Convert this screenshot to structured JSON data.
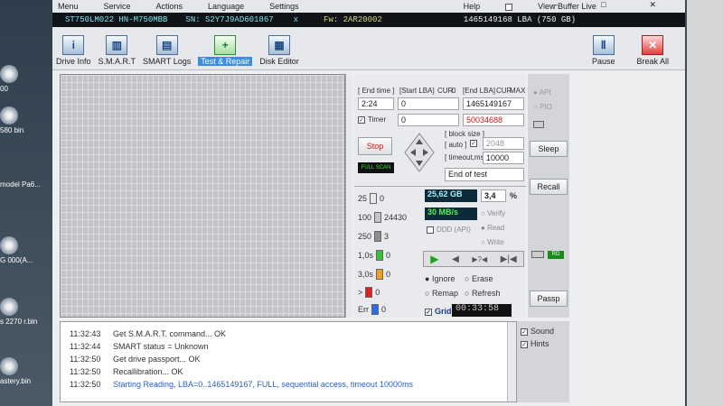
{
  "menu": {
    "items": [
      "Menu",
      "Service",
      "Actions",
      "Language",
      "Settings",
      "Help"
    ],
    "view_buffer": "View Buffer Live"
  },
  "info": {
    "model": "ST750LM022 HN-M750MBB",
    "serial": "SN: S2Y7J9AD601867",
    "close": "x",
    "fw": "Fw: 2AR20002",
    "lba": "1465149168 LBA (750 GB)"
  },
  "toolbar": {
    "drive_info": "Drive Info",
    "smart": "S.M.A.R.T",
    "smart_logs": "SMART Logs",
    "test_repair": "Test & Repair",
    "disk_editor": "Disk Editor",
    "pause": "Pause",
    "break_all": "Break All"
  },
  "controls": {
    "end_time_label": "[ End time ]",
    "start_lba_label": "[Start LBA]",
    "cur": "CUR",
    "zero": "0",
    "end_lba_label": "[End LBA]",
    "max": "MAX",
    "end_time": "2:24",
    "start_lba": "0",
    "end_lba": "1465149167",
    "timer_label": "Timer",
    "timer_value": "0",
    "current_lba": "50034688",
    "stop": "Stop",
    "full_scan": "FULL SCAN",
    "block_size_label": "[ block size ]",
    "auto_label": "[ auto ]",
    "block_size": "2048",
    "timeout_label": "[ timeout,ms ]",
    "timeout": "10000",
    "end_of_test": "End of test",
    "api": "API",
    "pio": "PIO",
    "sleep": "Sleep",
    "recall": "Recall",
    "passp": "Passp",
    "rd": "RD"
  },
  "stats": {
    "processed": "25,62 GB",
    "percent": "3,4",
    "percent_unit": "%",
    "speed": "30 MB/s",
    "verify": "Verify",
    "read": "Read",
    "write": "Write",
    "ddd": "DDD (API)",
    "ignore": "Ignore",
    "erase": "Erase",
    "remap": "Remap",
    "refresh": "Refresh",
    "grid": "Grid",
    "elapsed": "00:33:58",
    "blocks": [
      {
        "label": "25",
        "count": "0",
        "color": "#e8e8e8"
      },
      {
        "label": "100",
        "count": "24430",
        "color": "#c4c4c4"
      },
      {
        "label": "250",
        "count": "3",
        "color": "#8e8e8e"
      },
      {
        "label": "1,0s",
        "count": "0",
        "color": "#34c434"
      },
      {
        "label": "3,0s",
        "count": "0",
        "color": "#f0a020"
      },
      {
        "label": ">",
        "count": "0",
        "color": "#e02020"
      },
      {
        "label": "Err",
        "count": "0",
        "color": "#2a6ee0"
      }
    ]
  },
  "log": [
    {
      "time": "11:32:43",
      "msg": "Get S.M.A.R.T. command... OK"
    },
    {
      "time": "11:32:44",
      "msg": "SMART status = Unknown"
    },
    {
      "time": "11:32:50",
      "msg": "Get drive passport... OK"
    },
    {
      "time": "11:32:50",
      "msg": "Recallibration... OK"
    },
    {
      "time": "11:32:50",
      "msg": "Starting Reading, LBA=0..1465149167, FULL, sequential access, timeout 10000ms"
    }
  ],
  "options": {
    "sound": "Sound",
    "hints": "Hints"
  },
  "desktop": {
    "items": [
      "00",
      "580 bin",
      "model Pa6...",
      "G 000(A...",
      "s 2270 r.bin",
      "astery.bin"
    ]
  }
}
